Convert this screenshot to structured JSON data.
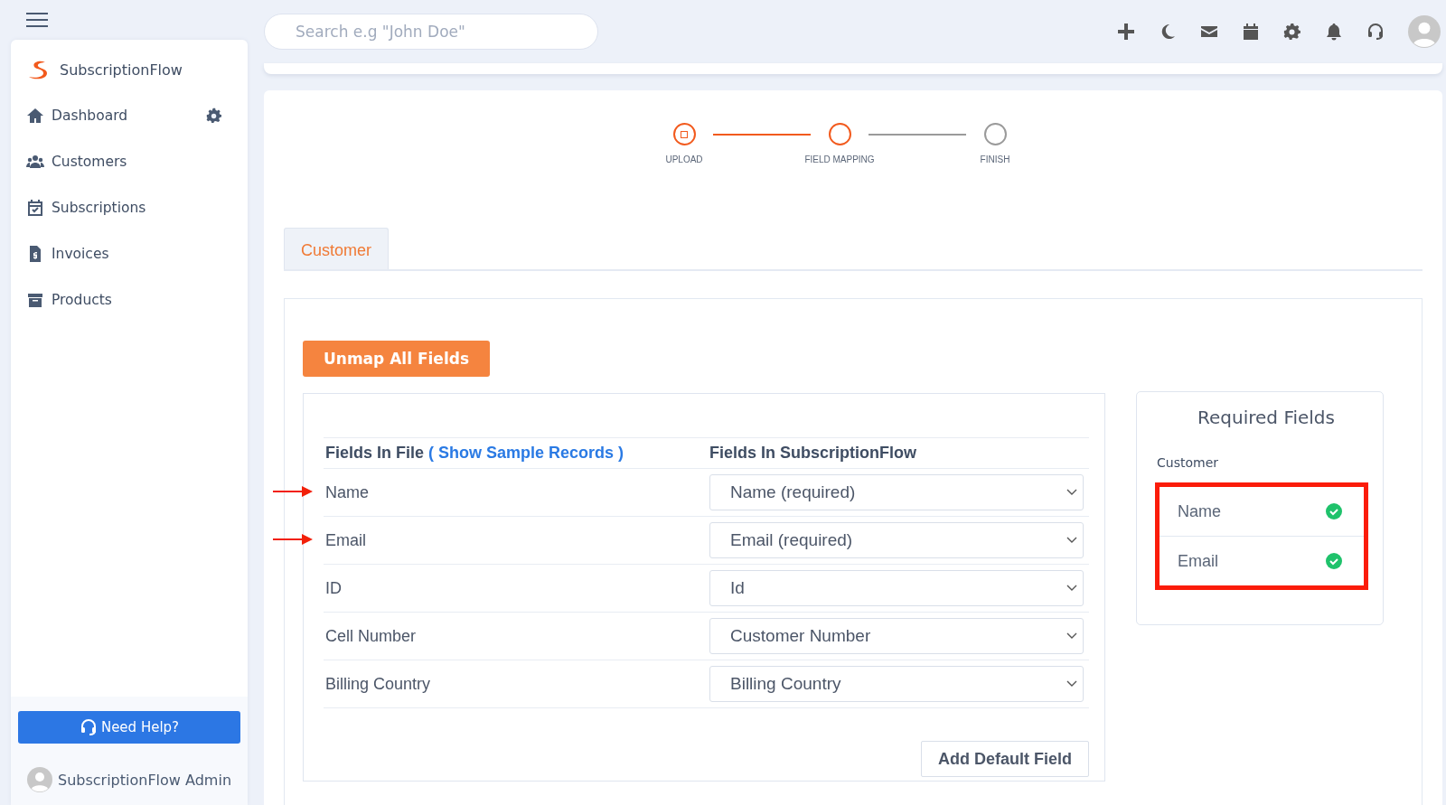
{
  "topbar": {
    "search": {
      "placeholder": "Search e.g \"John Doe\""
    }
  },
  "sidebar": {
    "brand": "SubscriptionFlow",
    "items": [
      {
        "label": "Dashboard",
        "has_settings": true
      },
      {
        "label": "Customers",
        "has_settings": false
      },
      {
        "label": "Subscriptions",
        "has_settings": false
      },
      {
        "label": "Invoices",
        "has_settings": false
      },
      {
        "label": "Products",
        "has_settings": false
      }
    ],
    "help_button": "Need Help?",
    "user": "SubscriptionFlow Admin"
  },
  "stepper": [
    {
      "label": "UPLOAD",
      "active": true,
      "completed": true
    },
    {
      "label": "FIELD MAPPING",
      "active": true,
      "completed": false
    },
    {
      "label": "FINISH",
      "active": false,
      "completed": false
    }
  ],
  "tabs": [
    {
      "label": "Customer",
      "selected": true
    }
  ],
  "unmap_button": "Unmap All Fields",
  "mapping": {
    "header_file": "Fields In File",
    "sample_link": "( Show Sample Records )",
    "header_flow": "Fields In SubscriptionFlow",
    "rows": [
      {
        "file_field": "Name",
        "mapped_to": "Name (required)",
        "marked": true
      },
      {
        "file_field": "Email",
        "mapped_to": "Email (required)",
        "marked": true
      },
      {
        "file_field": "ID",
        "mapped_to": "Id",
        "marked": false
      },
      {
        "file_field": "Cell Number",
        "mapped_to": "Customer Number",
        "marked": false
      },
      {
        "file_field": "Billing Country",
        "mapped_to": "Billing Country",
        "marked": false
      }
    ],
    "add_button": "Add Default Field"
  },
  "required": {
    "title": "Required Fields",
    "group": "Customer",
    "highlighted": true,
    "fields": [
      {
        "name": "Name",
        "checked": true
      },
      {
        "name": "Email",
        "checked": true
      }
    ]
  }
}
